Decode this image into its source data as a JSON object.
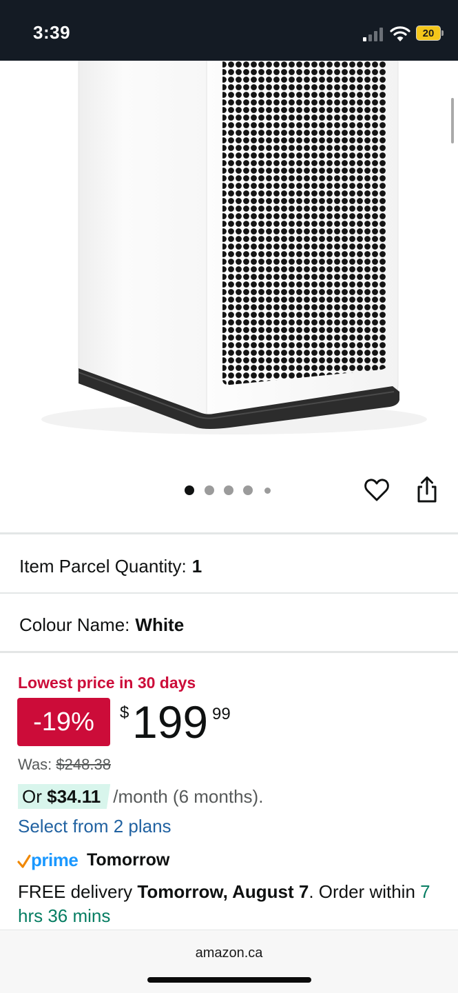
{
  "status_bar": {
    "time": "3:39",
    "battery_level": "20",
    "signal_bars_on": 1,
    "signal_bars_total": 4
  },
  "product": {
    "image_icon": "air-purifier-image",
    "carousel": {
      "total": 5,
      "active": 1
    },
    "wishlist_icon": "heart-icon",
    "share_icon": "share-icon"
  },
  "specs": {
    "quantity_label": "Item Parcel Quantity:",
    "quantity_value": "1",
    "colour_label": "Colour Name:",
    "colour_value": "White"
  },
  "pricing": {
    "lowest_label": "Lowest price in 30 days",
    "discount": "-19%",
    "currency_symbol": "$",
    "price_whole": "199",
    "price_fraction": "99",
    "was_label": "Was:",
    "was_price": "$248.38",
    "monthly_prefix": "Or",
    "monthly_amount": "$34.11",
    "monthly_suffix": "/month (6 months).",
    "plans_link": "Select from 2 plans"
  },
  "delivery": {
    "prime_label": "prime",
    "prime_day": "Tomorrow",
    "free_label": "FREE delivery",
    "date": "Tomorrow, August 7",
    "order_text": ". Order within",
    "countdown": "7 hrs 36 mins"
  },
  "footer": {
    "domain": "amazon.ca"
  },
  "colors": {
    "status_bar_bg": "#141b24",
    "deal_red": "#cc0c39",
    "link_blue": "#2162a1",
    "prime_blue": "#1a98ff",
    "prime_orange": "#f08804",
    "countdown_green": "#067d62",
    "monthly_chip_bg": "#d8f5ec",
    "battery_yellow": "#f4c61a"
  }
}
